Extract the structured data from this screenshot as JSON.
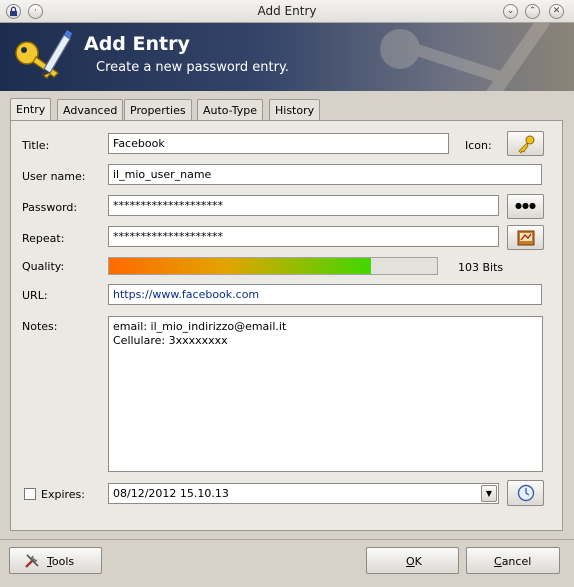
{
  "window": {
    "title": "Add Entry"
  },
  "banner": {
    "title": "Add Entry",
    "subtitle": "Create a new password entry."
  },
  "tabs": [
    {
      "label": "Entry",
      "active": true
    },
    {
      "label": "Advanced"
    },
    {
      "label": "Properties"
    },
    {
      "label": "Auto-Type"
    },
    {
      "label": "History"
    }
  ],
  "form": {
    "title_label": "Title:",
    "title_value": "Facebook",
    "icon_label": "Icon:",
    "username_label": "User name:",
    "username_value": "il_mio_user_name",
    "password_label": "Password:",
    "password_value": "********************",
    "repeat_label": "Repeat:",
    "repeat_value": "********************",
    "quality_label": "Quality:",
    "quality_text": "103 Bits",
    "quality_fraction": 0.8,
    "url_label": "URL:",
    "url_value": "https://www.facebook.com",
    "notes_label": "Notes:",
    "notes_line1": "email: il_mio_indirizzo@email.it",
    "notes_line2": "Cellulare:  3xxxxxxxx",
    "expires_label": "Expires:",
    "expires_checked": false,
    "expires_value": "08/12/2012 15.10.13",
    "password_toggle_label": "●●●"
  },
  "footer": {
    "tools_first": "T",
    "tools_rest": "ools",
    "ok_first": "O",
    "ok_rest": "K",
    "cancel_first": "C",
    "cancel_rest": "ancel"
  },
  "colors": {
    "banner_dark": "#1d2d4f",
    "quality_start": "#ff6a00",
    "quality_end": "#3fd800",
    "url_text": "#0b2e8a"
  }
}
